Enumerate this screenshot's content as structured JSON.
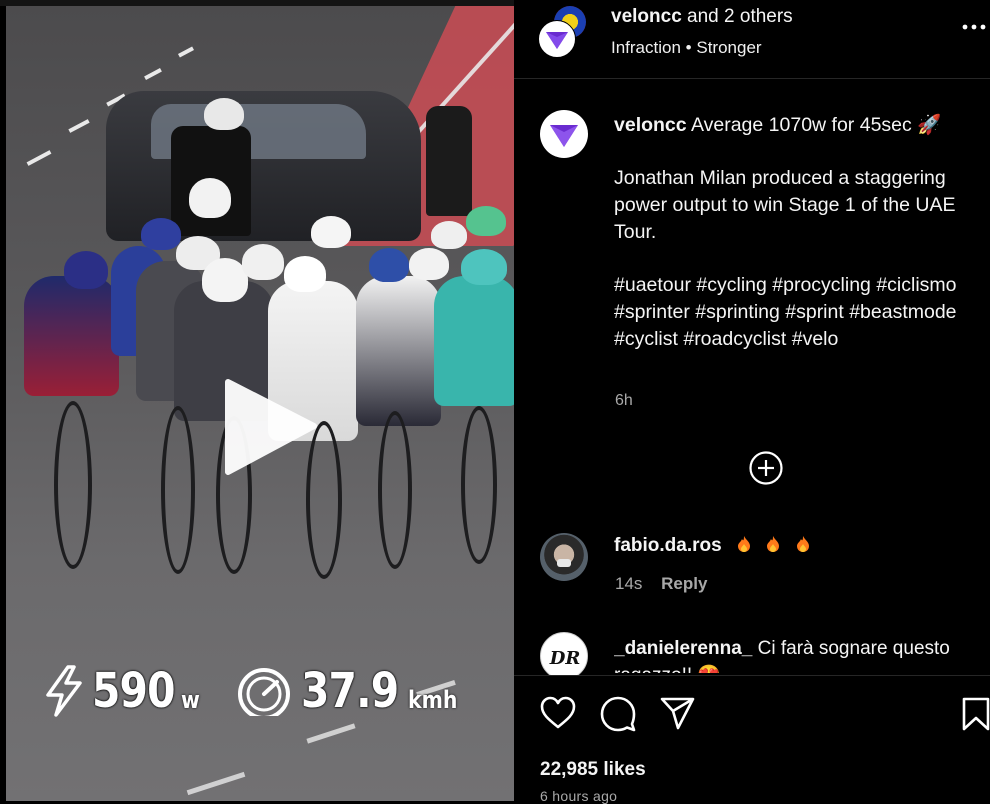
{
  "video": {
    "power_value": "590",
    "power_unit": "w",
    "speed_value": "37.9",
    "speed_unit": "kmh"
  },
  "post_header": {
    "username": "veloncc",
    "collaborators": "and 2 others",
    "audio_artist": "Infraction",
    "audio_separator": "•",
    "audio_track": "Stronger",
    "more_icon": "more-horizontal-icon"
  },
  "caption": {
    "username": "veloncc",
    "headline": "Average 1070w for 45sec",
    "emoji": "🚀",
    "body": "Jonathan Milan produced a staggering power output to win Stage 1 of the UAE Tour.",
    "hashtags": "#uaetour #cycling #procycling #ciclismo #sprinter #sprinting #sprint #beastmode #cyclist #roadcyclist #velo",
    "time": "6h"
  },
  "comments": [
    {
      "username": "fabio.da.ros",
      "text": "",
      "time": "14s",
      "reply_label": "Reply",
      "emoji_count": 3
    },
    {
      "username": "_danielerenna_",
      "text": "Ci farà sognare questo ragazzo!! 😍"
    }
  ],
  "actions": {
    "icons": [
      "heart-icon",
      "comment-icon",
      "share-icon",
      "bookmark-icon"
    ],
    "likes": "22,985 likes",
    "posted_ago": "6 hours ago"
  },
  "colors": {
    "background": "#000000",
    "text_secondary": "#a8a8a8",
    "divider": "#262626",
    "velon_purple": "#6a2bd0"
  }
}
